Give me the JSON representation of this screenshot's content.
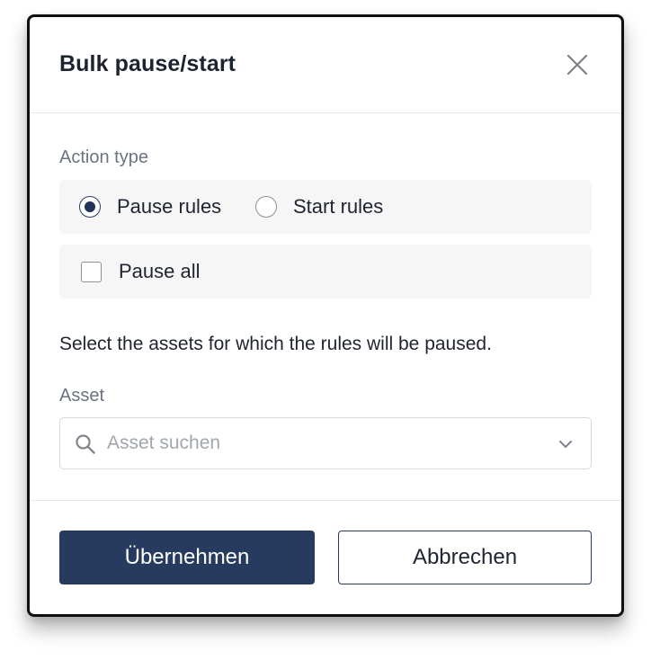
{
  "dialog": {
    "title": "Bulk pause/start",
    "close_icon": "close-icon"
  },
  "action_type": {
    "label": "Action type",
    "options": [
      {
        "label": "Pause rules",
        "selected": true
      },
      {
        "label": "Start rules",
        "selected": false
      }
    ]
  },
  "pause_all": {
    "label": "Pause all",
    "checked": false
  },
  "helper_text": "Select the assets for which the rules will be paused.",
  "asset": {
    "label": "Asset",
    "placeholder": "Asset suchen",
    "value": "",
    "search_icon": "search-icon",
    "dropdown_icon": "chevron-down-icon"
  },
  "footer": {
    "apply_label": "Übernehmen",
    "cancel_label": "Abbrechen"
  },
  "colors": {
    "primary": "#263b5e",
    "panel_background": "#f6f6f7",
    "muted_text": "#6b7280",
    "text": "#1f2430"
  }
}
